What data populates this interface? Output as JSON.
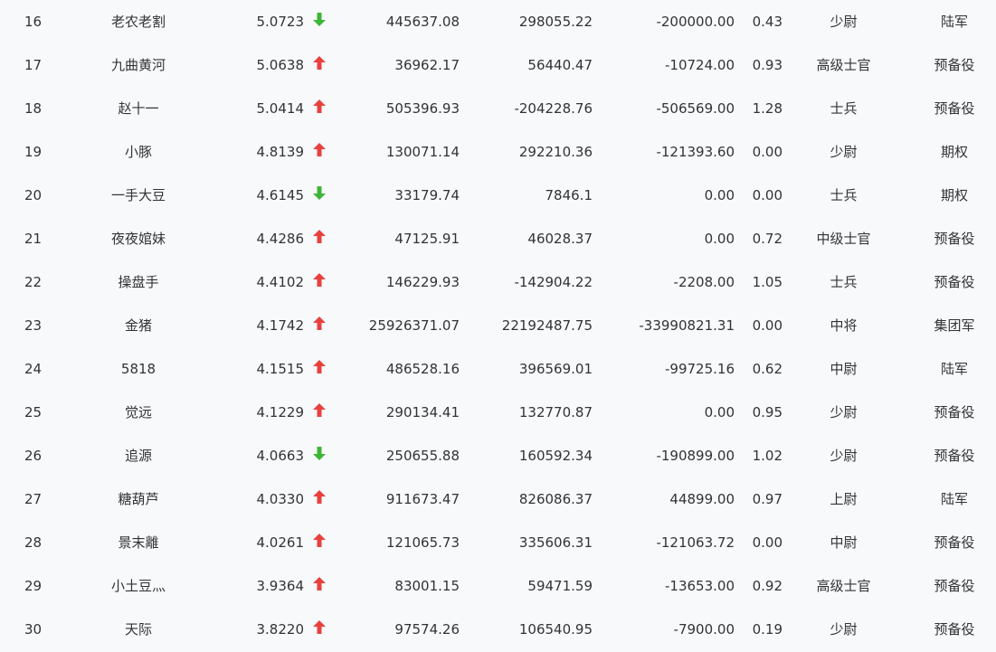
{
  "colors": {
    "background": "#f7f9fb",
    "text": "#333333",
    "arrow_up": "#e8413d",
    "arrow_down": "#3db536"
  },
  "rows": [
    {
      "rank": "16",
      "name": "老农老割",
      "ratio": "5.0723",
      "trend": "down",
      "v1": "445637.08",
      "v2": "298055.22",
      "v3": "-200000.00",
      "rate": "0.43",
      "rank_title": "少尉",
      "team": "陆军"
    },
    {
      "rank": "17",
      "name": "九曲黄河",
      "ratio": "5.0638",
      "trend": "up",
      "v1": "36962.17",
      "v2": "56440.47",
      "v3": "-10724.00",
      "rate": "0.93",
      "rank_title": "高级士官",
      "team": "预备役"
    },
    {
      "rank": "18",
      "name": "赵十一",
      "ratio": "5.0414",
      "trend": "up",
      "v1": "505396.93",
      "v2": "-204228.76",
      "v3": "-506569.00",
      "rate": "1.28",
      "rank_title": "士兵",
      "team": "预备役"
    },
    {
      "rank": "19",
      "name": "小豚",
      "ratio": "4.8139",
      "trend": "up",
      "v1": "130071.14",
      "v2": "292210.36",
      "v3": "-121393.60",
      "rate": "0.00",
      "rank_title": "少尉",
      "team": "期权"
    },
    {
      "rank": "20",
      "name": "一手大豆",
      "ratio": "4.6145",
      "trend": "down",
      "v1": "33179.74",
      "v2": "7846.1",
      "v3": "0.00",
      "rate": "0.00",
      "rank_title": "士兵",
      "team": "期权"
    },
    {
      "rank": "21",
      "name": "夜夜婠妹",
      "ratio": "4.4286",
      "trend": "up",
      "v1": "47125.91",
      "v2": "46028.37",
      "v3": "0.00",
      "rate": "0.72",
      "rank_title": "中级士官",
      "team": "预备役"
    },
    {
      "rank": "22",
      "name": "操盘手",
      "ratio": "4.4102",
      "trend": "up",
      "v1": "146229.93",
      "v2": "-142904.22",
      "v3": "-2208.00",
      "rate": "1.05",
      "rank_title": "士兵",
      "team": "预备役"
    },
    {
      "rank": "23",
      "name": "金猪",
      "ratio": "4.1742",
      "trend": "up",
      "v1": "25926371.07",
      "v2": "22192487.75",
      "v3": "-33990821.31",
      "rate": "0.00",
      "rank_title": "中将",
      "team": "集团军"
    },
    {
      "rank": "24",
      "name": "5818",
      "ratio": "4.1515",
      "trend": "up",
      "v1": "486528.16",
      "v2": "396569.01",
      "v3": "-99725.16",
      "rate": "0.62",
      "rank_title": "中尉",
      "team": "陆军"
    },
    {
      "rank": "25",
      "name": "觉远",
      "ratio": "4.1229",
      "trend": "up",
      "v1": "290134.41",
      "v2": "132770.87",
      "v3": "0.00",
      "rate": "0.95",
      "rank_title": "少尉",
      "team": "预备役"
    },
    {
      "rank": "26",
      "name": "追源",
      "ratio": "4.0663",
      "trend": "down",
      "v1": "250655.88",
      "v2": "160592.34",
      "v3": "-190899.00",
      "rate": "1.02",
      "rank_title": "少尉",
      "team": "预备役"
    },
    {
      "rank": "27",
      "name": "糖葫芦",
      "ratio": "4.0330",
      "trend": "up",
      "v1": "911673.47",
      "v2": "826086.37",
      "v3": "44899.00",
      "rate": "0.97",
      "rank_title": "上尉",
      "team": "陆军"
    },
    {
      "rank": "28",
      "name": "景末離",
      "ratio": "4.0261",
      "trend": "up",
      "v1": "121065.73",
      "v2": "335606.31",
      "v3": "-121063.72",
      "rate": "0.00",
      "rank_title": "中尉",
      "team": "预备役"
    },
    {
      "rank": "29",
      "name": "小土豆灬",
      "ratio": "3.9364",
      "trend": "up",
      "v1": "83001.15",
      "v2": "59471.59",
      "v3": "-13653.00",
      "rate": "0.92",
      "rank_title": "高级士官",
      "team": "预备役"
    },
    {
      "rank": "30",
      "name": "天际",
      "ratio": "3.8220",
      "trend": "up",
      "v1": "97574.26",
      "v2": "106540.95",
      "v3": "-7900.00",
      "rate": "0.19",
      "rank_title": "少尉",
      "team": "预备役"
    }
  ]
}
